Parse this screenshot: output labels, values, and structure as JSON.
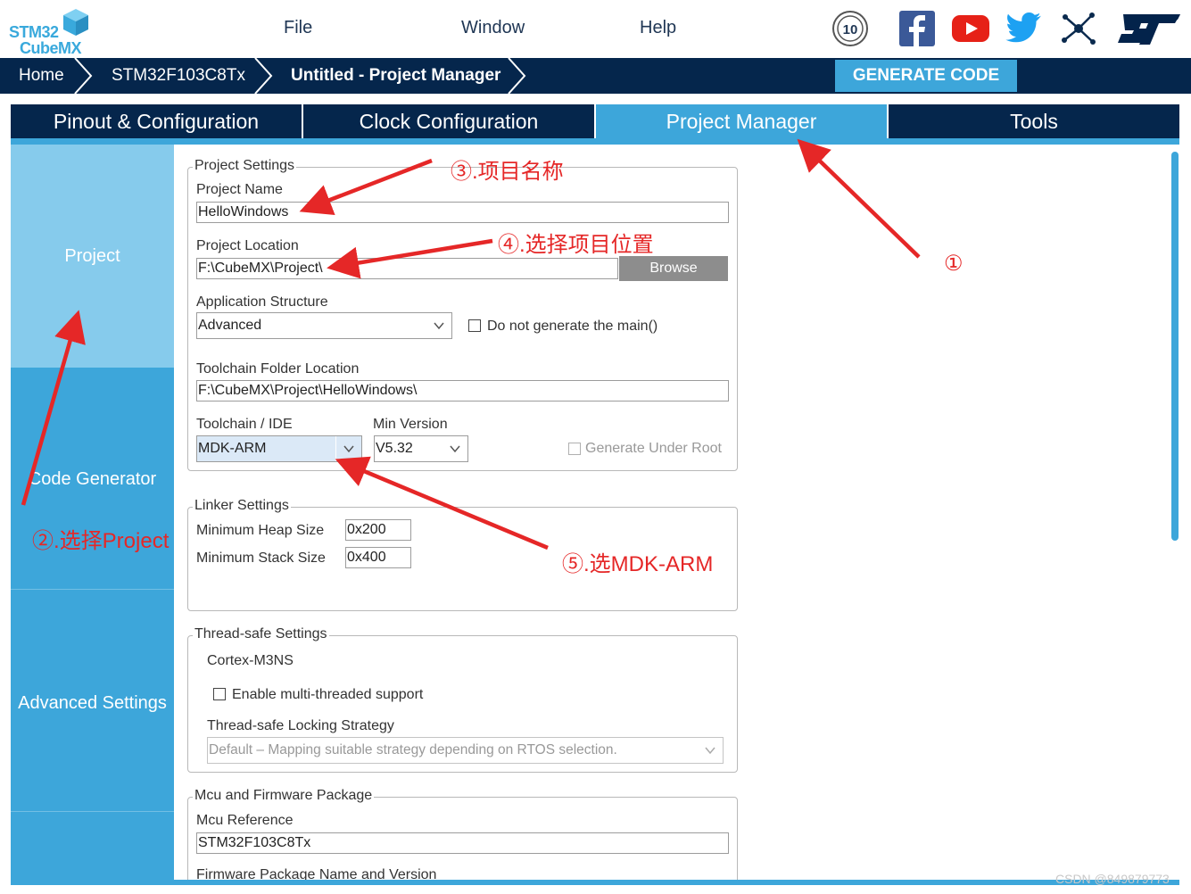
{
  "header": {
    "logo_text_line1": "STM32",
    "logo_text_line2": "CubeMX",
    "menu": [
      "File",
      "Window",
      "Help"
    ],
    "social_icons": [
      "anniversary-10-years-icon",
      "facebook-icon",
      "youtube-icon",
      "twitter-icon",
      "network-icon",
      "st-logo-icon"
    ]
  },
  "breadcrumb": {
    "items": [
      "Home",
      "STM32F103C8Tx",
      "Untitled - Project Manager"
    ],
    "generate_label": "GENERATE CODE"
  },
  "tabs": [
    "Pinout & Configuration",
    "Clock Configuration",
    "Project Manager",
    "Tools"
  ],
  "active_tab": "Project Manager",
  "sidenav": {
    "items": [
      "Project",
      "Code Generator",
      "Advanced Settings"
    ],
    "active": "Project"
  },
  "project_settings": {
    "legend": "Project Settings",
    "name_label": "Project Name",
    "name_value": "HelloWindows",
    "location_label": "Project Location",
    "location_value": "F:\\CubeMX\\Project\\",
    "browse_label": "Browse",
    "app_structure_label": "Application Structure",
    "app_structure_value": "Advanced",
    "no_main_label": "Do not generate the main()",
    "toolchain_folder_label": "Toolchain Folder Location",
    "toolchain_folder_value": "F:\\CubeMX\\Project\\HelloWindows\\",
    "toolchain_label": "Toolchain / IDE",
    "toolchain_value": "MDK-ARM",
    "min_version_label": "Min Version",
    "min_version_value": "V5.32",
    "generate_under_root_label": "Generate Under Root"
  },
  "linker_settings": {
    "legend": "Linker Settings",
    "heap_label": "Minimum Heap Size",
    "heap_value": "0x200",
    "stack_label": "Minimum Stack Size",
    "stack_value": "0x400"
  },
  "thread_safe": {
    "legend": "Thread-safe Settings",
    "core": "Cortex-M3NS",
    "multi_thread_label": "Enable multi-threaded support",
    "strategy_label": "Thread-safe Locking Strategy",
    "strategy_value": "Default  –  Mapping suitable strategy depending on RTOS selection."
  },
  "mcu_package": {
    "legend": "Mcu and Firmware Package",
    "ref_label": "Mcu Reference",
    "ref_value": "STM32F103C8Tx",
    "fw_label_partial": "Firmware Package Name and Version"
  },
  "annotations": {
    "a1": "①",
    "a2": "②.选择Project",
    "a3": "③.项目名称",
    "a4": "④.选择项目位置",
    "a5": "⑤.选MDK-ARM"
  },
  "watermark": "CSDN @849879773",
  "colors": {
    "navy": "#05264c",
    "accent": "#3da6da",
    "active_side": "#86cbec",
    "annotation": "#e52727"
  }
}
